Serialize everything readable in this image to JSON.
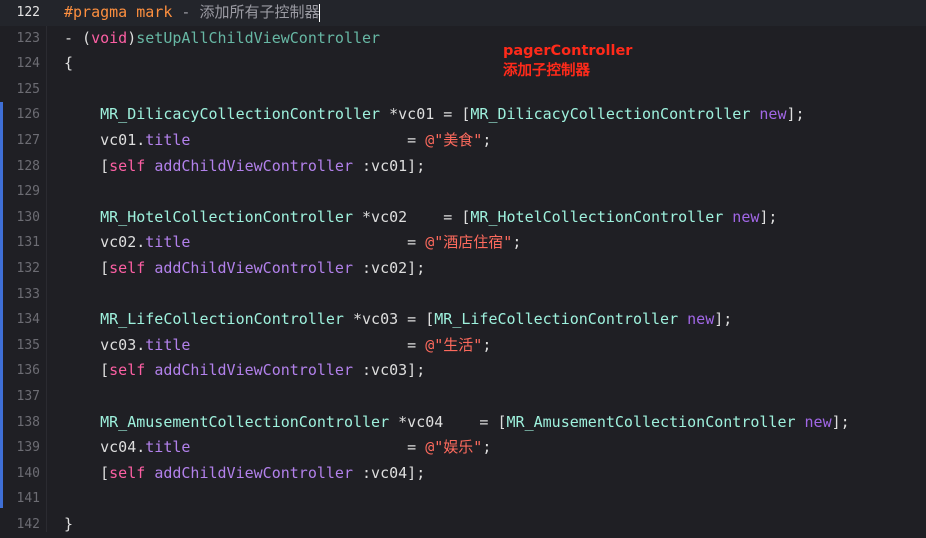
{
  "editor": {
    "lines": [
      {
        "number": "122",
        "current": true,
        "tokens": [
          {
            "t": "#pragma mark",
            "c": "tk-pre"
          },
          {
            "t": " - 添加所有子控制器",
            "c": "tk-cm"
          }
        ]
      },
      {
        "number": "123",
        "tokens": [
          {
            "t": "- (",
            "c": "tk-plain"
          },
          {
            "t": "void",
            "c": "tk-key"
          },
          {
            "t": ")",
            "c": "tk-plain"
          },
          {
            "t": "setUpAllChildViewController",
            "c": "tk-meth"
          }
        ]
      },
      {
        "number": "124",
        "tokens": [
          {
            "t": "{",
            "c": "tk-plain"
          }
        ]
      },
      {
        "number": "125",
        "tokens": []
      },
      {
        "number": "126",
        "tokens": [
          {
            "t": "    MR_DilicacyCollectionController",
            "c": "tk-type"
          },
          {
            "t": " *vc01 = [",
            "c": "tk-plain"
          },
          {
            "t": "MR_DilicacyCollectionController",
            "c": "tk-type"
          },
          {
            "t": " ",
            "c": "tk-plain"
          },
          {
            "t": "new",
            "c": "tk-new"
          },
          {
            "t": "];",
            "c": "tk-plain"
          }
        ]
      },
      {
        "number": "127",
        "tokens": [
          {
            "t": "    vc01.",
            "c": "tk-plain"
          },
          {
            "t": "title",
            "c": "tk-prop"
          },
          {
            "t": "                        = ",
            "c": "tk-plain"
          },
          {
            "t": "@\"美食\"",
            "c": "tk-str"
          },
          {
            "t": ";",
            "c": "tk-plain"
          }
        ]
      },
      {
        "number": "128",
        "tokens": [
          {
            "t": "    [",
            "c": "tk-plain"
          },
          {
            "t": "self",
            "c": "tk-key"
          },
          {
            "t": " ",
            "c": "tk-plain"
          },
          {
            "t": "addChildViewController",
            "c": "tk-prop"
          },
          {
            "t": " :vc01];",
            "c": "tk-plain"
          }
        ]
      },
      {
        "number": "129",
        "tokens": []
      },
      {
        "number": "130",
        "tokens": [
          {
            "t": "    MR_HotelCollectionController",
            "c": "tk-type"
          },
          {
            "t": " *vc02    = [",
            "c": "tk-plain"
          },
          {
            "t": "MR_HotelCollectionController",
            "c": "tk-type"
          },
          {
            "t": " ",
            "c": "tk-plain"
          },
          {
            "t": "new",
            "c": "tk-new"
          },
          {
            "t": "];",
            "c": "tk-plain"
          }
        ]
      },
      {
        "number": "131",
        "tokens": [
          {
            "t": "    vc02.",
            "c": "tk-plain"
          },
          {
            "t": "title",
            "c": "tk-prop"
          },
          {
            "t": "                        = ",
            "c": "tk-plain"
          },
          {
            "t": "@\"酒店住宿\"",
            "c": "tk-str"
          },
          {
            "t": ";",
            "c": "tk-plain"
          }
        ]
      },
      {
        "number": "132",
        "tokens": [
          {
            "t": "    [",
            "c": "tk-plain"
          },
          {
            "t": "self",
            "c": "tk-key"
          },
          {
            "t": " ",
            "c": "tk-plain"
          },
          {
            "t": "addChildViewController",
            "c": "tk-prop"
          },
          {
            "t": " :vc02];",
            "c": "tk-plain"
          }
        ]
      },
      {
        "number": "133",
        "tokens": []
      },
      {
        "number": "134",
        "tokens": [
          {
            "t": "    MR_LifeCollectionController",
            "c": "tk-type"
          },
          {
            "t": " *vc03 = [",
            "c": "tk-plain"
          },
          {
            "t": "MR_LifeCollectionController",
            "c": "tk-type"
          },
          {
            "t": " ",
            "c": "tk-plain"
          },
          {
            "t": "new",
            "c": "tk-new"
          },
          {
            "t": "];",
            "c": "tk-plain"
          }
        ]
      },
      {
        "number": "135",
        "tokens": [
          {
            "t": "    vc03.",
            "c": "tk-plain"
          },
          {
            "t": "title",
            "c": "tk-prop"
          },
          {
            "t": "                        = ",
            "c": "tk-plain"
          },
          {
            "t": "@\"生活\"",
            "c": "tk-str"
          },
          {
            "t": ";",
            "c": "tk-plain"
          }
        ]
      },
      {
        "number": "136",
        "tokens": [
          {
            "t": "    [",
            "c": "tk-plain"
          },
          {
            "t": "self",
            "c": "tk-key"
          },
          {
            "t": " ",
            "c": "tk-plain"
          },
          {
            "t": "addChildViewController",
            "c": "tk-prop"
          },
          {
            "t": " :vc03];",
            "c": "tk-plain"
          }
        ]
      },
      {
        "number": "137",
        "tokens": []
      },
      {
        "number": "138",
        "tokens": [
          {
            "t": "    MR_AmusementCollectionController",
            "c": "tk-type"
          },
          {
            "t": " *vc04    = [",
            "c": "tk-plain"
          },
          {
            "t": "MR_AmusementCollectionController",
            "c": "tk-type"
          },
          {
            "t": " ",
            "c": "tk-plain"
          },
          {
            "t": "new",
            "c": "tk-new"
          },
          {
            "t": "];",
            "c": "tk-plain"
          }
        ]
      },
      {
        "number": "139",
        "tokens": [
          {
            "t": "    vc04.",
            "c": "tk-plain"
          },
          {
            "t": "title",
            "c": "tk-prop"
          },
          {
            "t": "                        = ",
            "c": "tk-plain"
          },
          {
            "t": "@\"娱乐\"",
            "c": "tk-str"
          },
          {
            "t": ";",
            "c": "tk-plain"
          }
        ]
      },
      {
        "number": "140",
        "tokens": [
          {
            "t": "    [",
            "c": "tk-plain"
          },
          {
            "t": "self",
            "c": "tk-key"
          },
          {
            "t": " ",
            "c": "tk-plain"
          },
          {
            "t": "addChildViewController",
            "c": "tk-prop"
          },
          {
            "t": " :vc04];",
            "c": "tk-plain"
          }
        ]
      },
      {
        "number": "141",
        "tokens": []
      },
      {
        "number": "142",
        "tokens": [
          {
            "t": "}",
            "c": "tk-plain"
          }
        ]
      }
    ]
  },
  "annotation": {
    "line1": "pagerController",
    "line2": "添加子控制器"
  },
  "colors": {
    "background": "#1f1f24",
    "annotation": "#ff2a1a",
    "change_bar": "#3f6fd6"
  }
}
